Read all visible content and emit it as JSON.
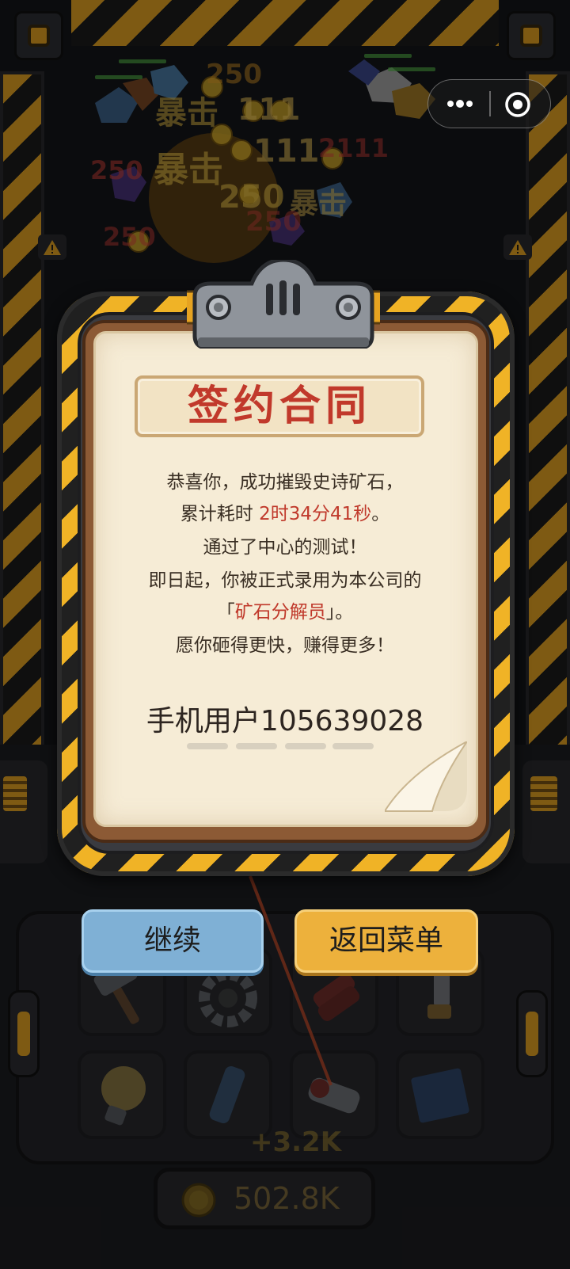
{
  "contract": {
    "title": "签约合同",
    "line1": "恭喜你，成功摧毁史诗矿石，",
    "line2_prefix": "累计耗时 ",
    "line2_time": "2时34分41秒",
    "line2_suffix": "。",
    "line3": "通过了中心的测试！",
    "line4": "即日起，你被正式录用为本公司的",
    "line5_open": "「",
    "line5_role": "矿石分解员",
    "line5_close": "」。",
    "line6": "愿你砸得更快，赚得更多！",
    "user_name": "手机用户105639028"
  },
  "buttons": {
    "continue_label": "继续",
    "menu_label": "返回菜单"
  },
  "game": {
    "income_popup": "+3.2K",
    "coin_total": "502.8K",
    "floating_texts": [
      "250",
      "暴击",
      "111",
      "250",
      "暴击",
      "111",
      "250",
      "暴击",
      "2111",
      "250",
      "250"
    ]
  },
  "miniprogram": {
    "more_icon": "more-dots-icon",
    "close_icon": "target-close-icon"
  },
  "colors": {
    "hazard_yellow": "#f0b326",
    "accent_red": "#c0392b",
    "continue_blue": "#7fb0d5",
    "menu_orange": "#edb13c"
  }
}
